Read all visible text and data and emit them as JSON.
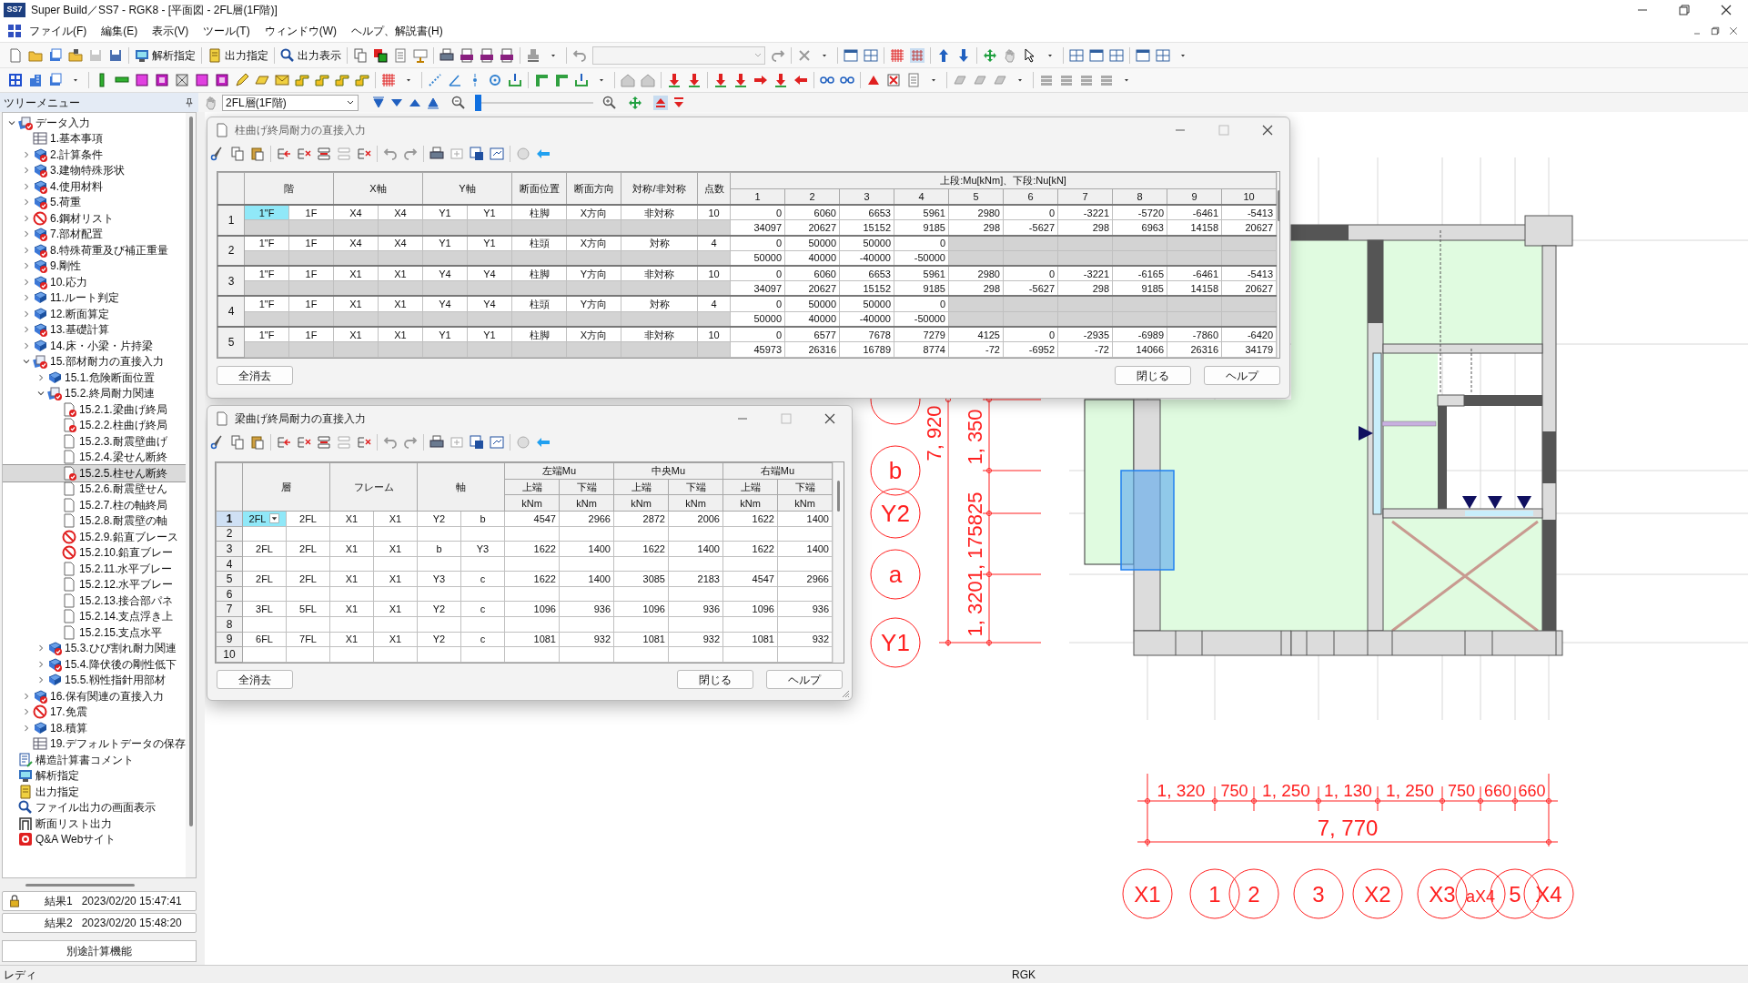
{
  "window": {
    "app_icon_text": "SS7",
    "title": "Super Build／SS7 - RGK8 - [平面図 - 2FL層(1F階)]"
  },
  "menu": [
    "ファイル(F)",
    "編集(E)",
    "表示(V)",
    "ツール(T)",
    "ウィンドウ(W)",
    "ヘルプ、解説書(H)"
  ],
  "toolbar": {
    "text_buttons": [
      "解析指定",
      "出力指定",
      "出力表示"
    ]
  },
  "view_bar": {
    "floor": "2FL層(1F階)",
    "zoom_slider": {
      "level": 0
    }
  },
  "tree": {
    "title": "ツリーメニュー",
    "items": [
      {
        "label": "データ入力",
        "kind": "stack",
        "checked": true,
        "expanded": true,
        "selected": false,
        "children": [
          {
            "label": "1.基本事項",
            "kind": "table",
            "checked": false,
            "selected": false
          },
          {
            "label": "2.計算条件",
            "kind": "book",
            "checked": true,
            "expanded": false,
            "selected": false
          },
          {
            "label": "3.建物特殊形状",
            "kind": "book",
            "checked": true,
            "expanded": false,
            "selected": false
          },
          {
            "label": "4.使用材料",
            "kind": "book",
            "checked": true,
            "expanded": false,
            "selected": false
          },
          {
            "label": "5.荷重",
            "kind": "book",
            "checked": true,
            "expanded": false,
            "selected": false
          },
          {
            "label": "6.鋼材リスト",
            "kind": "blocked",
            "checked": false,
            "expanded": false,
            "selected": false
          },
          {
            "label": "7.部材配置",
            "kind": "book",
            "checked": true,
            "expanded": false,
            "selected": false
          },
          {
            "label": "8.特殊荷重及び補正重量",
            "kind": "book",
            "checked": true,
            "expanded": false,
            "selected": false
          },
          {
            "label": "9.剛性",
            "kind": "book",
            "checked": true,
            "expanded": false,
            "selected": false
          },
          {
            "label": "10.応力",
            "kind": "book",
            "checked": true,
            "expanded": false,
            "selected": false
          },
          {
            "label": "11.ルート判定",
            "kind": "book",
            "checked": false,
            "expanded": false,
            "selected": false
          },
          {
            "label": "12.断面算定",
            "kind": "book",
            "checked": false,
            "expanded": false,
            "selected": false
          },
          {
            "label": "13.基礎計算",
            "kind": "book",
            "checked": true,
            "expanded": false,
            "selected": false
          },
          {
            "label": "14.床・小梁・片持梁",
            "kind": "book",
            "checked": false,
            "expanded": false,
            "selected": false
          },
          {
            "label": "15.部材耐力の直接入力",
            "kind": "stack",
            "checked": true,
            "expanded": true,
            "selected": false,
            "children": [
              {
                "label": "15.1.危険断面位置",
                "kind": "book",
                "checked": false,
                "expanded": false,
                "selected": false
              },
              {
                "label": "15.2.終局耐力関連",
                "kind": "stack",
                "checked": true,
                "expanded": true,
                "selected": false,
                "children": [
                  {
                    "label": "15.2.1.梁曲げ終局",
                    "kind": "page",
                    "checked": true,
                    "selected": false
                  },
                  {
                    "label": "15.2.2.柱曲げ終局",
                    "kind": "page",
                    "checked": true,
                    "selected": false
                  },
                  {
                    "label": "15.2.3.耐震壁曲げ",
                    "kind": "page",
                    "checked": false,
                    "selected": false
                  },
                  {
                    "label": "15.2.4.梁せん断終",
                    "kind": "page",
                    "checked": false,
                    "selected": false
                  },
                  {
                    "label": "15.2.5.柱せん断終",
                    "kind": "page",
                    "checked": true,
                    "selected": true
                  },
                  {
                    "label": "15.2.6.耐震壁せん",
                    "kind": "page",
                    "checked": false,
                    "selected": false
                  },
                  {
                    "label": "15.2.7.柱の軸終局",
                    "kind": "page",
                    "checked": false,
                    "selected": false
                  },
                  {
                    "label": "15.2.8.耐震壁の軸",
                    "kind": "page",
                    "checked": false,
                    "selected": false
                  },
                  {
                    "label": "15.2.9.鉛直ブレース",
                    "kind": "blocked",
                    "checked": false,
                    "selected": false
                  },
                  {
                    "label": "15.2.10.鉛直ブレー",
                    "kind": "blocked",
                    "checked": false,
                    "selected": false
                  },
                  {
                    "label": "15.2.11.水平ブレー",
                    "kind": "page",
                    "checked": false,
                    "selected": false
                  },
                  {
                    "label": "15.2.12.水平ブレー",
                    "kind": "page",
                    "checked": false,
                    "selected": false
                  },
                  {
                    "label": "15.2.13.接合部パネ",
                    "kind": "page",
                    "checked": false,
                    "selected": false
                  },
                  {
                    "label": "15.2.14.支点浮き上",
                    "kind": "page",
                    "checked": false,
                    "selected": false
                  },
                  {
                    "label": "15.2.15.支点水平",
                    "kind": "page",
                    "checked": false,
                    "selected": false
                  }
                ]
              },
              {
                "label": "15.3.ひび割れ耐力関連",
                "kind": "book",
                "checked": true,
                "expanded": false,
                "selected": false
              },
              {
                "label": "15.4.降伏後の剛性低下",
                "kind": "book",
                "checked": true,
                "expanded": false,
                "selected": false
              },
              {
                "label": "15.5.靱性指針用部材",
                "kind": "book",
                "checked": false,
                "expanded": false,
                "selected": false
              }
            ]
          },
          {
            "label": "16.保有関連の直接入力",
            "kind": "book",
            "checked": true,
            "expanded": false,
            "selected": false
          },
          {
            "label": "17.免震",
            "kind": "blocked",
            "checked": false,
            "expanded": false,
            "selected": false
          },
          {
            "label": "18.積算",
            "kind": "book",
            "checked": false,
            "expanded": false,
            "selected": false
          },
          {
            "label": "19.デフォルトデータの保存",
            "kind": "table",
            "checked": false,
            "selected": false
          }
        ]
      },
      {
        "label": "構造計算書コメント",
        "kind": "comment",
        "selected": false
      },
      {
        "label": "解析指定",
        "kind": "monitor",
        "selected": false
      },
      {
        "label": "出力指定",
        "kind": "scroll",
        "selected": false
      },
      {
        "label": "ファイル出力の画面表示",
        "kind": "magnifier",
        "selected": false
      },
      {
        "label": "断面リスト出力",
        "kind": "section",
        "selected": false
      },
      {
        "label": "Q&A Webサイト",
        "kind": "qa",
        "selected": false
      }
    ]
  },
  "results": [
    {
      "label": "結果1",
      "time": "2023/02/20 15:47:41",
      "locked": true
    },
    {
      "label": "結果2",
      "time": "2023/02/20 15:48:20",
      "locked": false
    }
  ],
  "separate_calc_button": "別途計算機能",
  "column_dialog": {
    "title": "柱曲げ終局耐力の直接入力",
    "columns": [
      "階",
      "X軸",
      "Y軸",
      "断面位置",
      "断面方向",
      "対称/非対称",
      "点数"
    ],
    "group_header": "上段:Mu[kNm]、下段:Nu[kN]",
    "point_headers": [
      "1",
      "2",
      "3",
      "4",
      "5",
      "6",
      "7",
      "8",
      "9",
      "10"
    ],
    "rows": [
      {
        "num": "1",
        "selected": true,
        "floor": [
          "1\"F",
          "1F"
        ],
        "x": [
          "X4",
          "X4"
        ],
        "y": [
          "Y1",
          "Y1"
        ],
        "position": "柱脚",
        "direction": "X方向",
        "symmetry": "非対称",
        "points": "10",
        "mu": [
          "0",
          "6060",
          "6653",
          "5961",
          "2980",
          "0",
          "-3221",
          "-5720",
          "-6461",
          "-5413"
        ],
        "nu": [
          "34097",
          "20627",
          "15152",
          "9185",
          "298",
          "-5627",
          "298",
          "6963",
          "14158",
          "20627"
        ]
      },
      {
        "num": "2",
        "selected": false,
        "floor": [
          "1\"F",
          "1F"
        ],
        "x": [
          "X4",
          "X4"
        ],
        "y": [
          "Y1",
          "Y1"
        ],
        "position": "柱頭",
        "direction": "X方向",
        "symmetry": "対称",
        "points": "4",
        "mu": [
          "0",
          "50000",
          "50000",
          "0"
        ],
        "nu": [
          "50000",
          "40000",
          "-40000",
          "-50000"
        ]
      },
      {
        "num": "3",
        "selected": false,
        "floor": [
          "1\"F",
          "1F"
        ],
        "x": [
          "X1",
          "X1"
        ],
        "y": [
          "Y4",
          "Y4"
        ],
        "position": "柱脚",
        "direction": "Y方向",
        "symmetry": "非対称",
        "points": "10",
        "mu": [
          "0",
          "6060",
          "6653",
          "5961",
          "2980",
          "0",
          "-3221",
          "-6165",
          "-6461",
          "-5413"
        ],
        "nu": [
          "34097",
          "20627",
          "15152",
          "9185",
          "298",
          "-5627",
          "298",
          "9185",
          "14158",
          "20627"
        ]
      },
      {
        "num": "4",
        "selected": false,
        "floor": [
          "1\"F",
          "1F"
        ],
        "x": [
          "X1",
          "X1"
        ],
        "y": [
          "Y4",
          "Y4"
        ],
        "position": "柱頭",
        "direction": "Y方向",
        "symmetry": "対称",
        "points": "4",
        "mu": [
          "0",
          "50000",
          "50000",
          "0"
        ],
        "nu": [
          "50000",
          "40000",
          "-40000",
          "-50000"
        ]
      },
      {
        "num": "5",
        "selected": false,
        "floor": [
          "1\"F",
          "1F"
        ],
        "x": [
          "X1",
          "X1"
        ],
        "y": [
          "Y1",
          "Y1"
        ],
        "position": "柱脚",
        "direction": "X方向",
        "symmetry": "非対称",
        "points": "10",
        "mu": [
          "0",
          "6577",
          "7678",
          "7279",
          "4125",
          "0",
          "-2935",
          "-6989",
          "-7860",
          "-6420"
        ],
        "nu": [
          "45973",
          "26316",
          "16789",
          "8774",
          "-72",
          "-6952",
          "-72",
          "14066",
          "26316",
          "34179"
        ]
      }
    ],
    "buttons": [
      "全消去",
      "閉じる",
      "ヘルプ"
    ]
  },
  "beam_dialog": {
    "title": "梁曲げ終局耐力の直接入力",
    "columns": [
      "層",
      "フレーム",
      "軸"
    ],
    "groups": [
      "左端Mu",
      "中央Mu",
      "右端Mu"
    ],
    "sub_headers": [
      "上端",
      "下端",
      "上端",
      "下端",
      "上端",
      "下端"
    ],
    "units": [
      "kNm",
      "kNm",
      "kNm",
      "kNm",
      "kNm",
      "kNm"
    ],
    "rows": [
      {
        "num": "1",
        "selected": true,
        "cells": [
          "2FL",
          "2FL",
          "X1",
          "X1",
          "Y2",
          "b",
          "4547",
          "2966",
          "2872",
          "2006",
          "1622",
          "1400"
        ]
      },
      {
        "num": "2",
        "selected": false
      },
      {
        "num": "3",
        "selected": false,
        "cells": [
          "2FL",
          "2FL",
          "X1",
          "X1",
          "b",
          "Y3",
          "1622",
          "1400",
          "1622",
          "1400",
          "1622",
          "1400"
        ]
      },
      {
        "num": "4",
        "selected": false
      },
      {
        "num": "5",
        "selected": false,
        "cells": [
          "2FL",
          "2FL",
          "X1",
          "X1",
          "Y3",
          "c",
          "1622",
          "1400",
          "3085",
          "2183",
          "4547",
          "2966"
        ]
      },
      {
        "num": "6",
        "selected": false
      },
      {
        "num": "7",
        "selected": false,
        "cells": [
          "3FL",
          "5FL",
          "X1",
          "X1",
          "Y2",
          "c",
          "1096",
          "936",
          "1096",
          "936",
          "1096",
          "936"
        ]
      },
      {
        "num": "8",
        "selected": false
      },
      {
        "num": "9",
        "selected": false,
        "cells": [
          "6FL",
          "7FL",
          "X1",
          "X1",
          "Y2",
          "c",
          "1081",
          "932",
          "1081",
          "932",
          "1081",
          "932"
        ]
      },
      {
        "num": "10",
        "selected": false
      }
    ],
    "buttons": [
      "全消去",
      "閉じる",
      "ヘルプ"
    ]
  },
  "plan": {
    "y_axes": [
      "b",
      "Y2",
      "a",
      "Y1"
    ],
    "y_dims": [
      "7, 920",
      "1, 3201, 175825",
      "1, 350"
    ],
    "x_dims": [
      "1, 320",
      "750",
      "1, 250",
      "1, 130",
      "1, 250",
      "750",
      "660",
      "660"
    ],
    "x_total": "7, 770",
    "x_axes": [
      "X1",
      "1",
      "2",
      "3",
      "X2",
      "X3",
      "aX4",
      "5",
      "X4"
    ]
  },
  "status_bar": {
    "left": "レディ",
    "center": "RGK"
  }
}
